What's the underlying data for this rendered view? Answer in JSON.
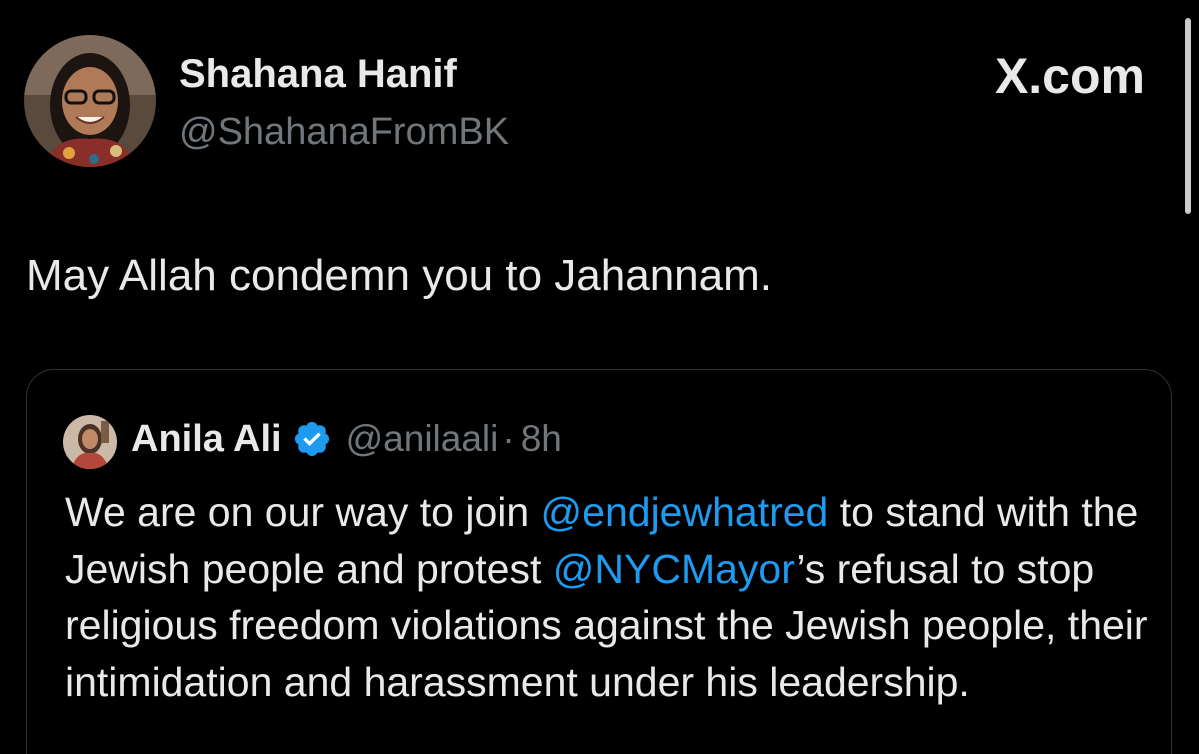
{
  "header": {
    "display_name": "Shahana Hanif",
    "handle": "@ShahanaFromBK",
    "brand": "X.com"
  },
  "tweet": {
    "text": "May Allah condemn you to Jahannam."
  },
  "quoted_tweet": {
    "author_name": "Anila Ali",
    "handle": "@anilaali",
    "separator": "·",
    "time": "8h",
    "verified_badge_icon": "verified-badge-icon",
    "body_parts": {
      "p1": "We are on our way to join ",
      "m1": "@endjewhatred",
      "p2": "  to stand with the Jewish people and protest ",
      "m2": "@NYCMayor",
      "p3": "’s refusal to stop religious freedom violations against the Jewish people, their intimidation and harassment under his leadership."
    }
  },
  "colors": {
    "background": "#000000",
    "primary_text": "#e7e9ea",
    "secondary_text": "#71767b",
    "link": "#1d9bf0",
    "verified": "#1d9bf0",
    "card_border": "#2f3336"
  }
}
